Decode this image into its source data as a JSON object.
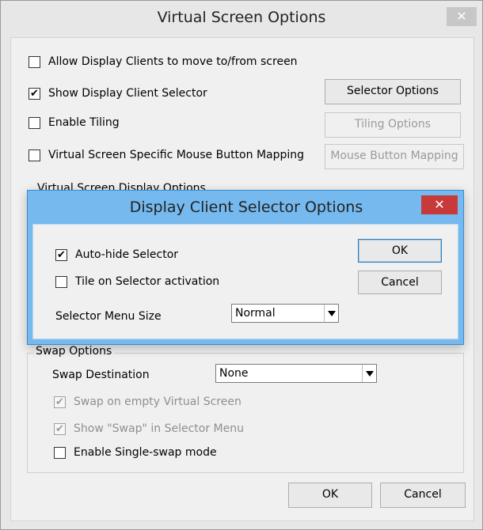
{
  "main_dialog": {
    "title": "Virtual Screen Options",
    "close_glyph": "✕",
    "options": {
      "allow_move": {
        "label": "Allow Display Clients to move to/from screen",
        "checked": false
      },
      "show_selector": {
        "label": "Show Display Client Selector",
        "checked": true
      },
      "enable_tiling": {
        "label": "Enable Tiling",
        "checked": false
      },
      "mouse_mapping": {
        "label": "Virtual Screen Specific Mouse Button Mapping",
        "checked": false
      }
    },
    "buttons": {
      "selector_options": "Selector Options",
      "tiling_options": "Tiling Options",
      "mouse_button_mapping": "Mouse Button Mapping",
      "ok": "OK",
      "cancel": "Cancel"
    },
    "virtual_display_group": {
      "legend": "Virtual Screen Display Options"
    },
    "swap_group": {
      "legend": "Swap Options",
      "destination_label": "Swap Destination",
      "destination_value": "None",
      "swap_on_empty": {
        "label": "Swap on empty Virtual Screen",
        "checked": true,
        "enabled": false
      },
      "show_swap_in_menu": {
        "label": "Show \"Swap\" in Selector Menu",
        "checked": true,
        "enabled": false
      },
      "single_swap": {
        "label": "Enable Single-swap mode",
        "checked": false
      }
    }
  },
  "popup_dialog": {
    "title": "Display Client Selector Options",
    "close_glyph": "✕",
    "auto_hide": {
      "label": "Auto-hide Selector",
      "checked": true
    },
    "tile_on_activation": {
      "label": "Tile on Selector activation",
      "checked": false
    },
    "menu_size_label": "Selector Menu Size",
    "menu_size_value": "Normal",
    "ok": "OK",
    "cancel": "Cancel"
  },
  "glyphs": {
    "check": "✔",
    "empty": ""
  },
  "colors": {
    "popup_frame": "#75b9ee",
    "close_active": "#c8393a",
    "close_inactive": "#c7c7c7"
  }
}
